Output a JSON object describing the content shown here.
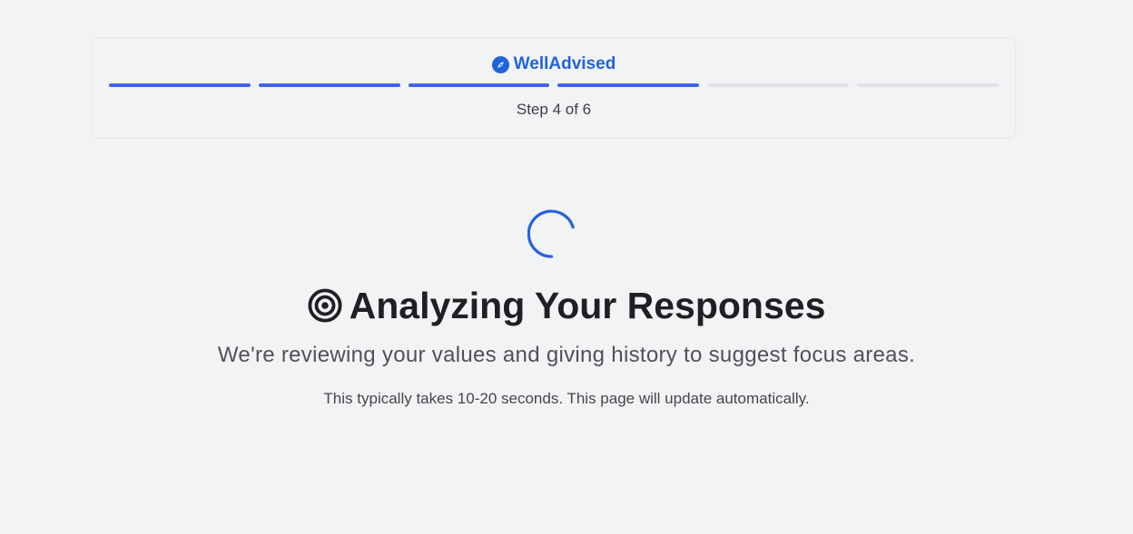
{
  "brand": {
    "name": "WellAdvised",
    "icon": "compass-icon",
    "color": "#1f63dc"
  },
  "progress": {
    "current_step": 4,
    "total_steps": 6,
    "label": "Step 4 of 6",
    "active_color": "#4263e6",
    "inactive_color": "#e1e3e8"
  },
  "loading": {
    "spinner_icon": "loading-spinner-icon",
    "title_icon": "bullseye-target-icon",
    "title": "Analyzing Your Responses",
    "subtitle": "We're reviewing your values and giving history to suggest focus areas.",
    "note": "This typically takes 10-20 seconds. This page will update automatically."
  }
}
